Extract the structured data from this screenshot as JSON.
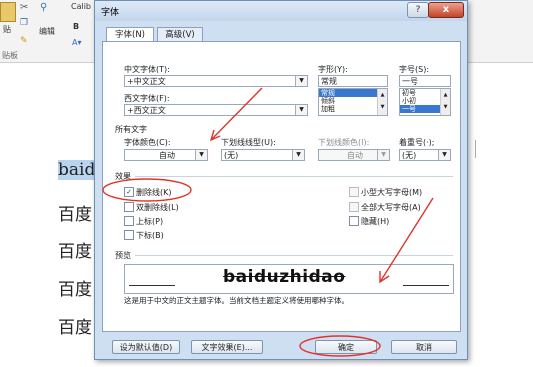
{
  "background": {
    "ribbon": {
      "paste_label": "贴",
      "font_name": "Calib",
      "edit_label": "编辑",
      "clipboard_label": "贴板",
      "bold_label": "B"
    },
    "document_lines": [
      "baid",
      "百度",
      "百度",
      "百度",
      "百度"
    ]
  },
  "dialog": {
    "title": "字体",
    "help_label": "?",
    "close_label": "x",
    "tabs": [
      {
        "label": "字体(N)",
        "active": true
      },
      {
        "label": "高级(V)",
        "active": false
      }
    ],
    "chinese_font": {
      "label": "中文字体(T):",
      "value": "+中文正文"
    },
    "western_font": {
      "label": "西文字体(F):",
      "value": "+西文正文"
    },
    "style": {
      "label": "字形(Y):",
      "value": "常规",
      "options": [
        "常规",
        "倾斜",
        "加粗"
      ],
      "selected": "常规"
    },
    "size": {
      "label": "字号(S):",
      "value": "一号",
      "options": [
        "初号",
        "小初",
        "一号"
      ],
      "selected": "一号"
    },
    "all_text": {
      "section_label": "所有文字",
      "font_color_label": "字体颜色(C):",
      "font_color_value": "自动",
      "underline_type_label": "下划线线型(U):",
      "underline_type_value": "(无)",
      "underline_color_label": "下划线颜色(I):",
      "underline_color_value": "自动",
      "emphasis_label": "着重号(·);",
      "emphasis_value": "(无)"
    },
    "effects": {
      "section_label": "效果",
      "left": [
        {
          "label": "删除线(K)",
          "checked": true,
          "enabled": true
        },
        {
          "label": "双删除线(L)",
          "checked": false,
          "enabled": true
        },
        {
          "label": "上标(P)",
          "checked": false,
          "enabled": true
        },
        {
          "label": "下标(B)",
          "checked": false,
          "enabled": true
        }
      ],
      "right": [
        {
          "label": "小型大写字母(M)",
          "checked": false,
          "enabled": false
        },
        {
          "label": "全部大写字母(A)",
          "checked": false,
          "enabled": false
        },
        {
          "label": "隐藏(H)",
          "checked": false,
          "enabled": true
        }
      ]
    },
    "preview": {
      "section_label": "预览",
      "sample_text": "baiduzhidao",
      "description": "这是用于中文的正文主题字体。当前文档主题定义将使用哪种字体。"
    },
    "buttons": {
      "set_default": "设为默认值(D)",
      "text_effects": "文字效果(E)...",
      "ok": "确定",
      "cancel": "取消"
    },
    "colors": {
      "annotation_red": "#e0342b",
      "selection_blue": "#3a78d0"
    }
  }
}
